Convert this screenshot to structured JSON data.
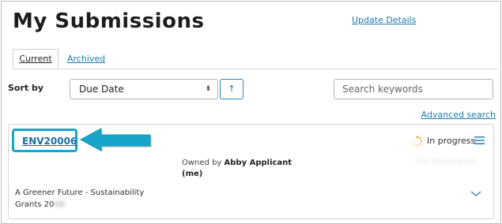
{
  "page": {
    "title": "My Submissions",
    "update_details": "Update Details"
  },
  "tabs": [
    {
      "label": "Current",
      "active": true
    },
    {
      "label": "Archived",
      "active": false
    }
  ],
  "sort": {
    "label": "Sort by",
    "selected": "Due Date",
    "direction": "↑"
  },
  "search": {
    "placeholder": "Search keywords",
    "value": ""
  },
  "advanced_search": "Advanced search",
  "submission": {
    "id": "ENV20006",
    "status": "In progress",
    "owned_by_prefix": "Owned by",
    "owner": "Abby Applicant",
    "owner_suffix": "(me)",
    "due_date_redacted": "Due date redacted",
    "program_line1": "A Greener Future - Sustainability",
    "program_line2": "Grants 20",
    "program_year_redacted": "XX"
  },
  "colors": {
    "link": "#1a7cae",
    "accent_cyan": "#17a6c9",
    "status_icon": "#f0a020"
  },
  "icons": {
    "select_caret": "updown-caret-icon",
    "status": "spinner-icon",
    "menu": "hamburger-menu-icon",
    "expand": "chevron-down-icon",
    "callout": "arrow-left-icon"
  }
}
